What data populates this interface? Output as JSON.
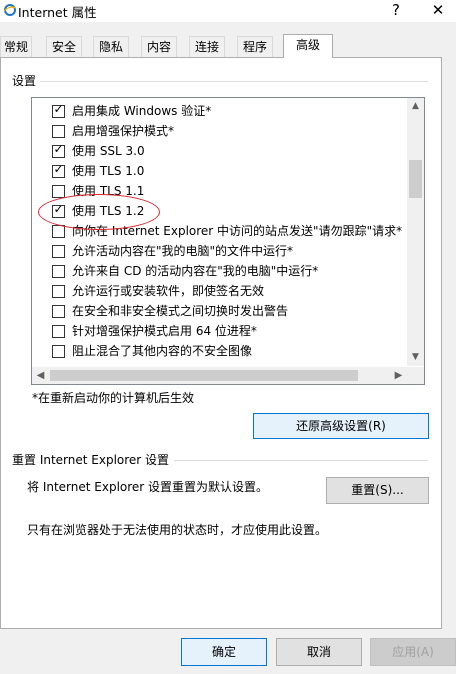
{
  "window": {
    "title": "Internet 属性",
    "help": "?",
    "close": "✕"
  },
  "tabs": [
    {
      "label": "常规"
    },
    {
      "label": "安全"
    },
    {
      "label": "隐私"
    },
    {
      "label": "内容"
    },
    {
      "label": "连接"
    },
    {
      "label": "程序"
    },
    {
      "label": "高级",
      "active": true
    }
  ],
  "settings": {
    "group_label": "设置",
    "items": [
      {
        "label": "启用集成 Windows 验证*",
        "checked": true
      },
      {
        "label": "启用增强保护模式*",
        "checked": false
      },
      {
        "label": "使用 SSL 3.0",
        "checked": true
      },
      {
        "label": "使用 TLS 1.0",
        "checked": true
      },
      {
        "label": "使用 TLS 1.1",
        "checked": false
      },
      {
        "label": "使用 TLS 1.2",
        "checked": true
      },
      {
        "label": "向你在 Internet Explorer 中访问的站点发送\"请勿跟踪\"请求*",
        "checked": false
      },
      {
        "label": "允许活动内容在\"我的电脑\"的文件中运行*",
        "checked": false
      },
      {
        "label": "允许来自 CD 的活动内容在\"我的电脑\"中运行*",
        "checked": false
      },
      {
        "label": "允许运行或安装软件，即使签名无效",
        "checked": false
      },
      {
        "label": "在安全和非安全模式之间切换时发出警告",
        "checked": false
      },
      {
        "label": "针对增强保护模式启用 64 位进程*",
        "checked": false
      },
      {
        "label": "阻止混合了其他内容的不安全图像",
        "checked": false
      }
    ],
    "restart_note": "*在重新启动你的计算机后生效",
    "restore_button": "还原高级设置(R)"
  },
  "reset": {
    "group_label": "重置 Internet Explorer 设置",
    "description": "将 Internet Explorer 设置重置为默认设置。",
    "button": "重置(S)...",
    "note": "只有在浏览器处于无法使用的状态时，才应使用此设置。"
  },
  "footer": {
    "ok": "确定",
    "cancel": "取消",
    "apply": "应用(A)"
  },
  "colors": {
    "annotation": "#e0242b",
    "focus": "#0078d7"
  }
}
